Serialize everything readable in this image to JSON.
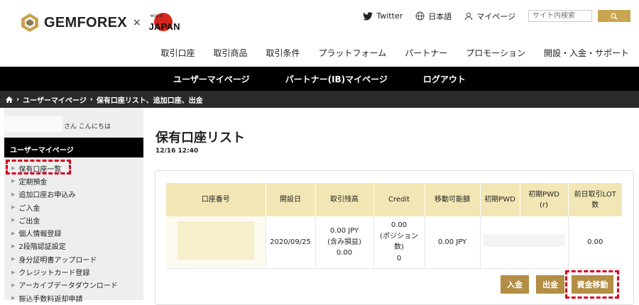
{
  "brand": {
    "logo_text": "GEMFOREX",
    "cross": "×",
    "japan_badge": "JAPAN",
    "made_in": "MADE IN"
  },
  "util": {
    "twitter_label": "Twitter",
    "language_label": "日本語",
    "mypage_label": "マイページ",
    "search_placeholder": "サイト内検索",
    "icons": [
      "twitter-icon",
      "globe-icon",
      "user-icon",
      "search-icon"
    ]
  },
  "mainnav": [
    "取引口座",
    "取引商品",
    "取引条件",
    "プラットフォーム",
    "パートナー",
    "プロモーション",
    "開設・入金・サポート"
  ],
  "blackbar": [
    "ユーザーマイページ",
    "パートナー(IB)マイページ",
    "ログアウト"
  ],
  "breadcrumb": {
    "home_icon": "home-icon",
    "items": [
      "ユーザーマイページ",
      "保有口座リスト、追加口座、出金"
    ]
  },
  "sidebar": {
    "greeting": "さん こんにちは",
    "heading": "ユーザーマイページ",
    "items": [
      "保有口座一覧",
      "定期預金",
      "追加口座お申込み",
      "ご入金",
      "ご出金",
      "個人情報登録",
      "2段階認証設定",
      "身分証明書アップロード",
      "クレジットカード登録",
      "アーカイブデータダウンロード",
      "振込手数料返却申請"
    ]
  },
  "main": {
    "title": "保有口座リスト",
    "timestamp": "12/16 12:40",
    "table": {
      "headers": [
        "口座番号",
        "開設日",
        "取引残高",
        "Credit",
        "移動可能額",
        "初期PWD",
        "初期PWD\n(r)",
        "前日取引LOT\n数"
      ],
      "row": {
        "open_date": "2020/09/25",
        "balance": "0.00 JPY\n(含み損益)\n0.00",
        "credit": "0.00\n(ポジション\n数)\n0",
        "transferable": "0.00 JPY",
        "prev_lot": "0.00"
      }
    },
    "buttons": {
      "deposit": "入金",
      "withdraw": "出金",
      "transfer": "資金移動"
    }
  },
  "colors": {
    "gold": "#b38e45",
    "table_header": "#f2e7b4",
    "highlight": "#d5001c",
    "black_bar": "#000000"
  }
}
